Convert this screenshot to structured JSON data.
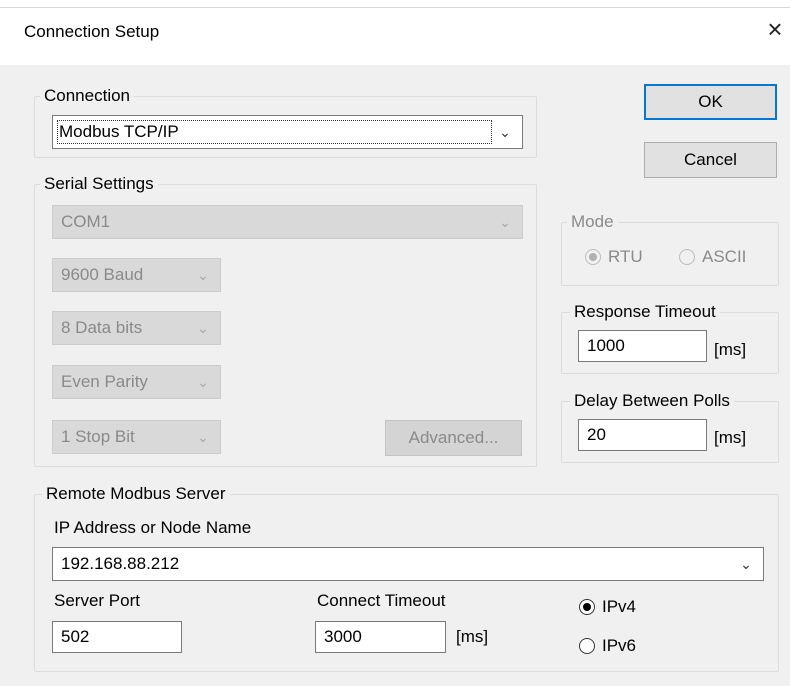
{
  "window": {
    "title": "Connection Setup",
    "close_glyph": "×"
  },
  "connection": {
    "legend": "Connection",
    "selected": "Modbus TCP/IP"
  },
  "buttons": {
    "ok": "OK",
    "cancel": "Cancel",
    "advanced": "Advanced..."
  },
  "serial": {
    "legend": "Serial Settings",
    "port": "COM1",
    "baud": "9600 Baud",
    "data_bits": "8 Data bits",
    "parity": "Even Parity",
    "stop_bits": "1 Stop Bit"
  },
  "mode": {
    "legend": "Mode",
    "rtu": "RTU",
    "ascii": "ASCII",
    "selected": "RTU"
  },
  "response_timeout": {
    "legend": "Response Timeout",
    "value": "1000",
    "unit": "[ms]"
  },
  "delay_between_polls": {
    "legend": "Delay Between Polls",
    "value": "20",
    "unit": "[ms]"
  },
  "remote": {
    "legend": "Remote Modbus Server",
    "ip_label": "IP Address or Node Name",
    "ip_value": "192.168.88.212",
    "port_label": "Server Port",
    "port_value": "502",
    "connect_timeout_label": "Connect Timeout",
    "connect_timeout_value": "3000",
    "connect_timeout_unit": "[ms]",
    "ipv4": "IPv4",
    "ipv6": "IPv6",
    "selected_ip_version": "IPv4"
  }
}
